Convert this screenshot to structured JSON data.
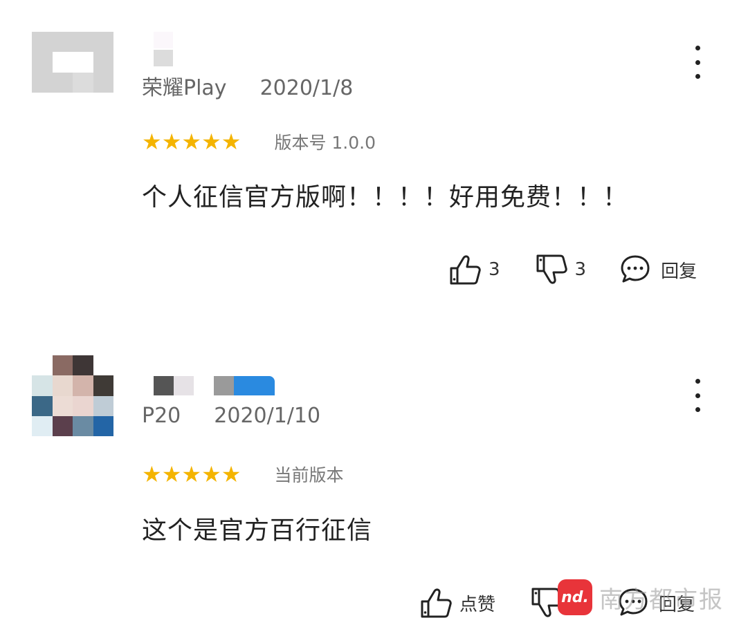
{
  "colors": {
    "star": "#f4b400",
    "accent": "#e8343a",
    "text": "#222222",
    "meta": "#666666"
  },
  "reviews": [
    {
      "user_label": "荣耀Play",
      "date": "2020/1/8",
      "stars": "★★★★★",
      "rating": 5,
      "version": "版本号 1.0.0",
      "content": "个人征信官方版啊！！！！好用免费！！！",
      "like_label": "3",
      "dislike_label": "3",
      "reply_label": "回复"
    },
    {
      "user_label": "P20",
      "date": "2020/1/10",
      "stars": "★★★★★",
      "rating": 5,
      "version": "当前版本",
      "content": "这个是官方百行征信",
      "like_label": "点赞",
      "dislike_label": "",
      "reply_label": "回复"
    }
  ],
  "watermark": {
    "logo": "nd.",
    "text": "南方都市报"
  },
  "icons": {
    "more": "more-vertical-icon",
    "like": "thumbs-up-icon",
    "dislike": "thumbs-down-icon",
    "reply": "comment-icon"
  }
}
